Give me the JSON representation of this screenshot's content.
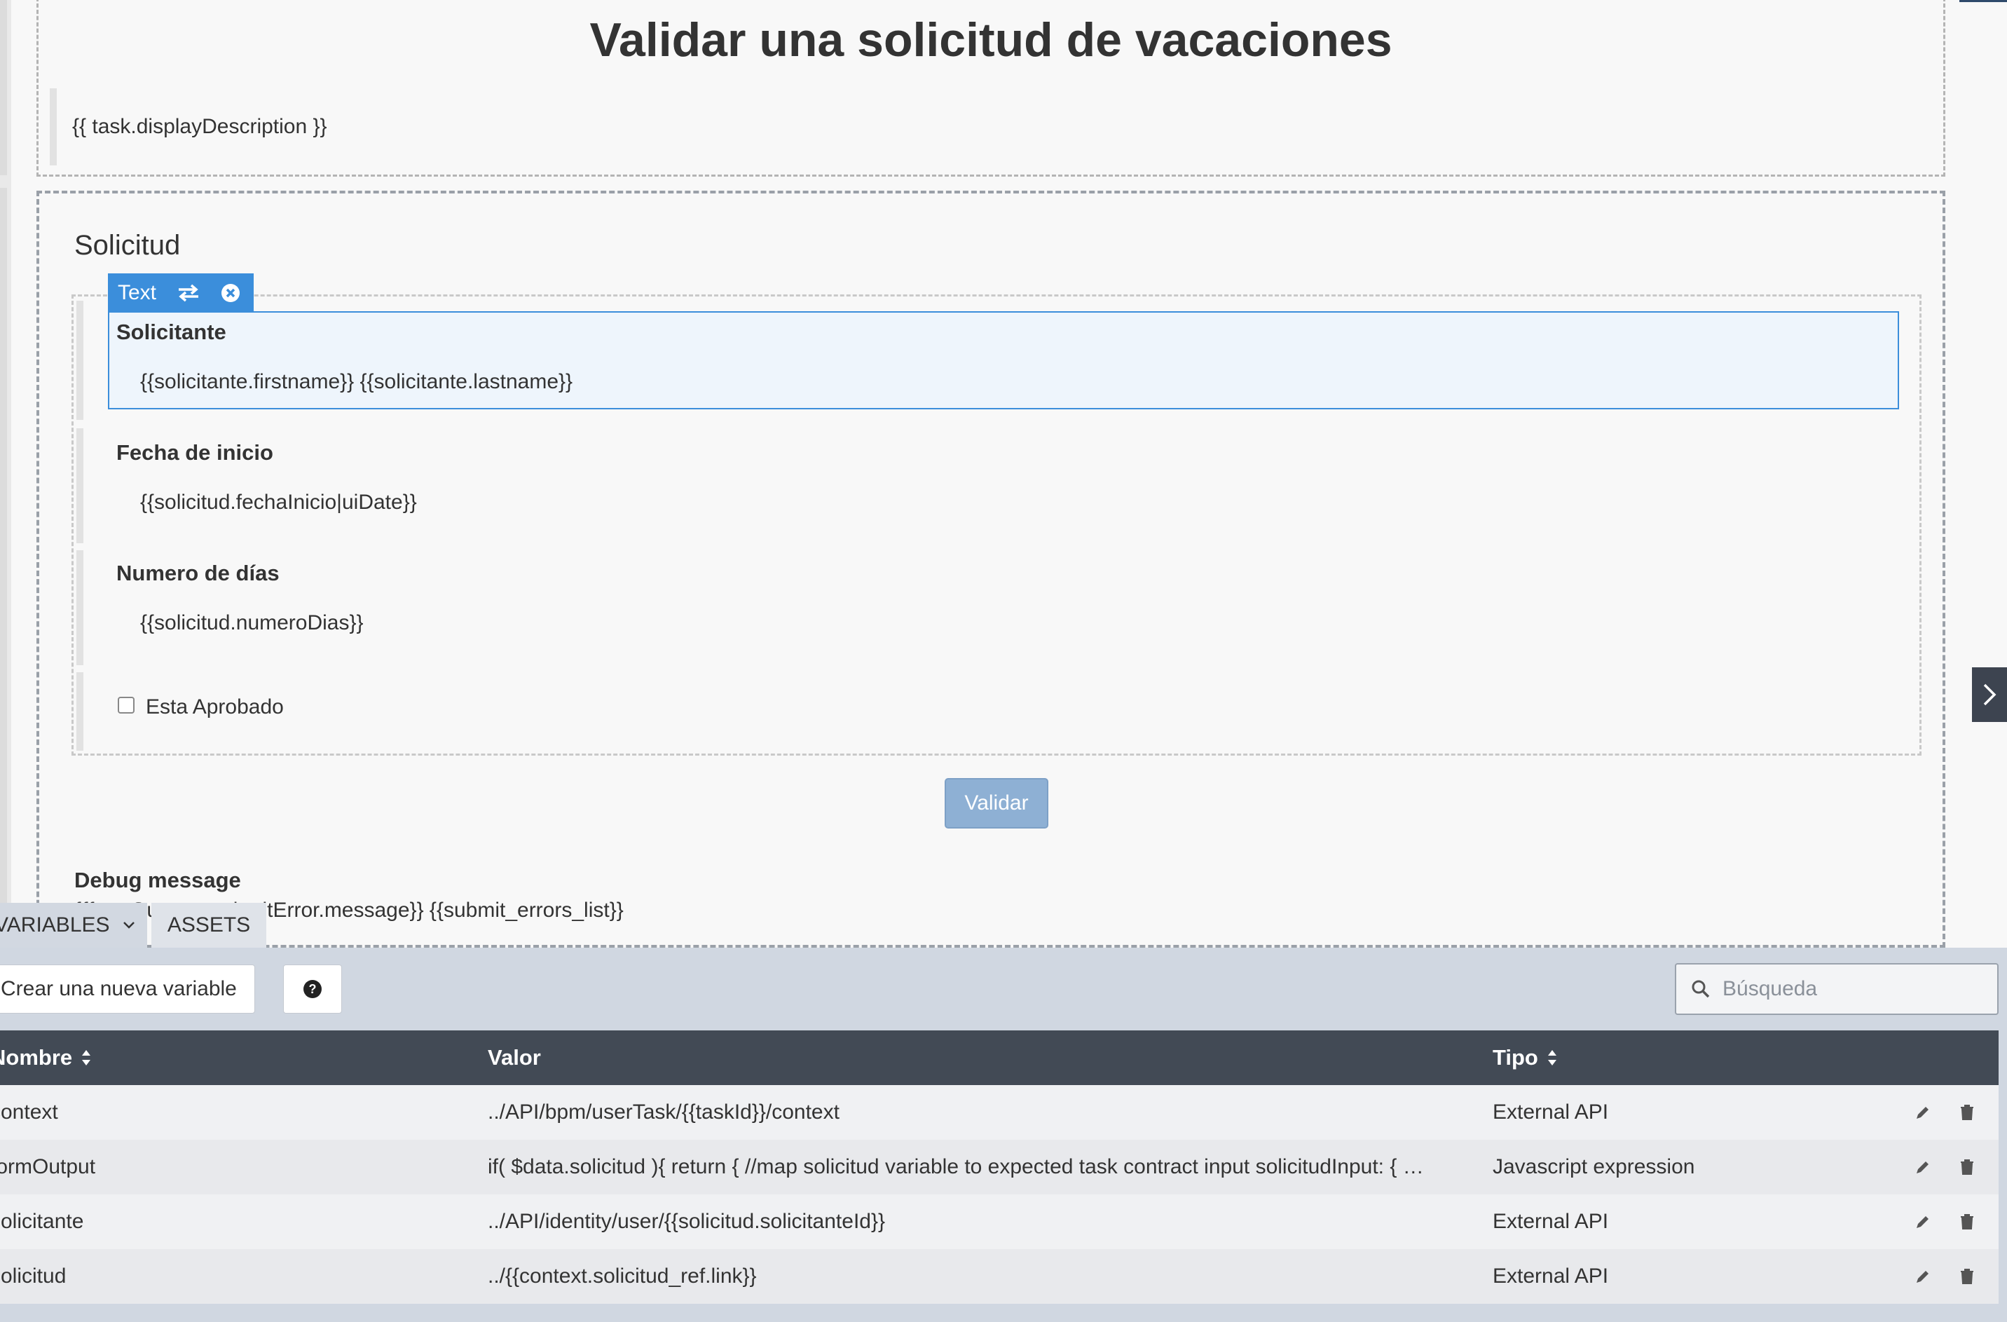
{
  "page": {
    "title": "Validar una solicitud de vacaciones",
    "description": "{{ task.displayDescription }}"
  },
  "form": {
    "section_title": "Solicitud",
    "selected_widget": {
      "badge_label": "Text",
      "icons": [
        "swap-icon",
        "close-icon"
      ]
    },
    "fields": [
      {
        "label": "Solicitante",
        "value": "{{solicitante.firstname}} {{solicitante.lastname}}"
      },
      {
        "label": "Fecha de inicio",
        "value": "{{solicitud.fechaInicio|uiDate}}"
      },
      {
        "label": "Numero de días",
        "value": "{{solicitud.numeroDias}}"
      }
    ],
    "checkbox": {
      "label": "Esta Aprobado",
      "checked": false
    },
    "submit_label": "Validar",
    "debug": {
      "title": "Debug message",
      "expression": "{{formOutput._submitError.message}} {{submit_errors_list}}"
    }
  },
  "side_toggle": {
    "icon": "chevron-right-icon"
  },
  "bottom_panel": {
    "tabs": [
      {
        "label": "VARIABLES",
        "icon": "chevron-down-icon",
        "active": true
      },
      {
        "label": "ASSETS",
        "active": false
      }
    ],
    "create_button": "Crear una nueva variable",
    "help_icon": "question-circle-icon",
    "search": {
      "placeholder": "Búsqueda",
      "value": "",
      "icon": "search-icon"
    },
    "table": {
      "columns": [
        {
          "label": "Nombre",
          "sortable": true
        },
        {
          "label": "Valor",
          "sortable": false
        },
        {
          "label": "Tipo",
          "sortable": true
        }
      ],
      "rows": [
        {
          "name": "context",
          "value": "../API/bpm/userTask/{{taskId}}/context",
          "type": "External API"
        },
        {
          "name": "formOutput",
          "value": "if( $data.solicitud ){ return { //map solicitud variable to expected task contract input solicitudInput: { …",
          "type": "Javascript expression"
        },
        {
          "name": "solicitante",
          "value": "../API/identity/user/{{solicitud.solicitanteId}}",
          "type": "External API"
        },
        {
          "name": "solicitud",
          "value": "../{{context.solicitud_ref.link}}",
          "type": "External API"
        }
      ],
      "row_actions": [
        "pencil-icon",
        "trash-icon"
      ]
    }
  },
  "colors": {
    "accent": "#3b8edb",
    "header_dark": "#424a55",
    "panel_bg": "#d0d7e1",
    "button_disabled": "#8eb0d4"
  }
}
